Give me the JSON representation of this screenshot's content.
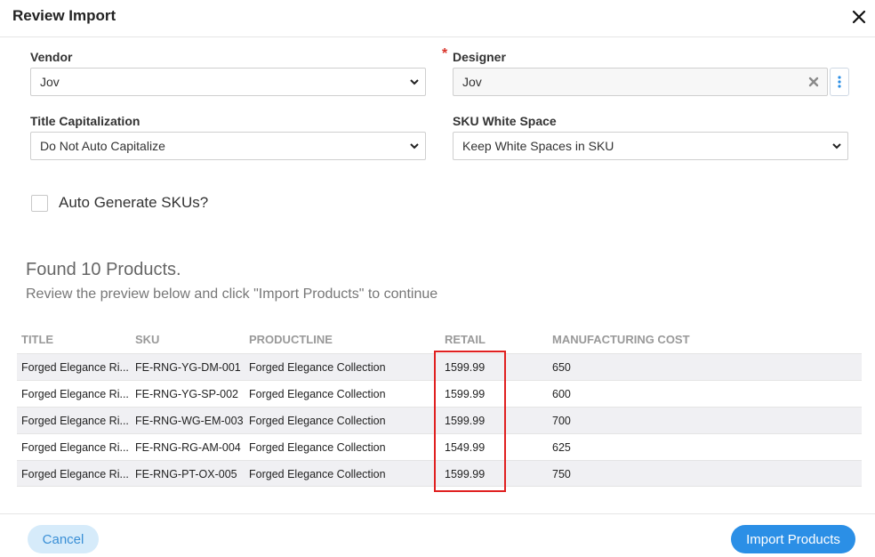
{
  "dialog": {
    "title": "Review Import"
  },
  "form": {
    "vendor": {
      "label": "Vendor",
      "value": "Jov"
    },
    "designer": {
      "label": "Designer",
      "required_mark": "*",
      "value": "Jov"
    },
    "title_capitalization": {
      "label": "Title Capitalization",
      "value": "Do Not Auto Capitalize"
    },
    "sku_white_space": {
      "label": "SKU White Space",
      "value": "Keep White Spaces in SKU"
    },
    "auto_generate": {
      "label": "Auto Generate SKUs?",
      "checked": false
    }
  },
  "summary": {
    "found": "Found 10 Products.",
    "instructions": "Review the preview below and click \"Import Products\" to continue"
  },
  "table": {
    "headers": [
      "TITLE",
      "SKU",
      "PRODUCTLINE",
      "RETAIL",
      "MANUFACTURING COST"
    ],
    "rows": [
      [
        "Forged Elegance Ri...",
        "FE-RNG-YG-DM-001",
        "Forged Elegance Collection",
        "1599.99",
        "650"
      ],
      [
        "Forged Elegance Ri...",
        "FE-RNG-YG-SP-002",
        "Forged Elegance Collection",
        "1599.99",
        "600"
      ],
      [
        "Forged Elegance Ri...",
        "FE-RNG-WG-EM-003",
        "Forged Elegance Collection",
        "1599.99",
        "700"
      ],
      [
        "Forged Elegance Ri...",
        "FE-RNG-RG-AM-004",
        "Forged Elegance Collection",
        "1549.99",
        "625"
      ],
      [
        "Forged Elegance Ri...",
        "FE-RNG-PT-OX-005",
        "Forged Elegance Collection",
        "1599.99",
        "750"
      ]
    ]
  },
  "footer": {
    "cancel_label": "Cancel",
    "import_label": "Import Products"
  },
  "colors": {
    "primary": "#2b8fe6",
    "cancel_bg": "#d6ebfa",
    "highlight": "#e02020",
    "required": "#d9342b"
  },
  "icons": {
    "close": "close-icon",
    "chevron": "chevron-down-icon",
    "clear": "clear-x-icon",
    "kebab": "kebab-menu-icon"
  }
}
